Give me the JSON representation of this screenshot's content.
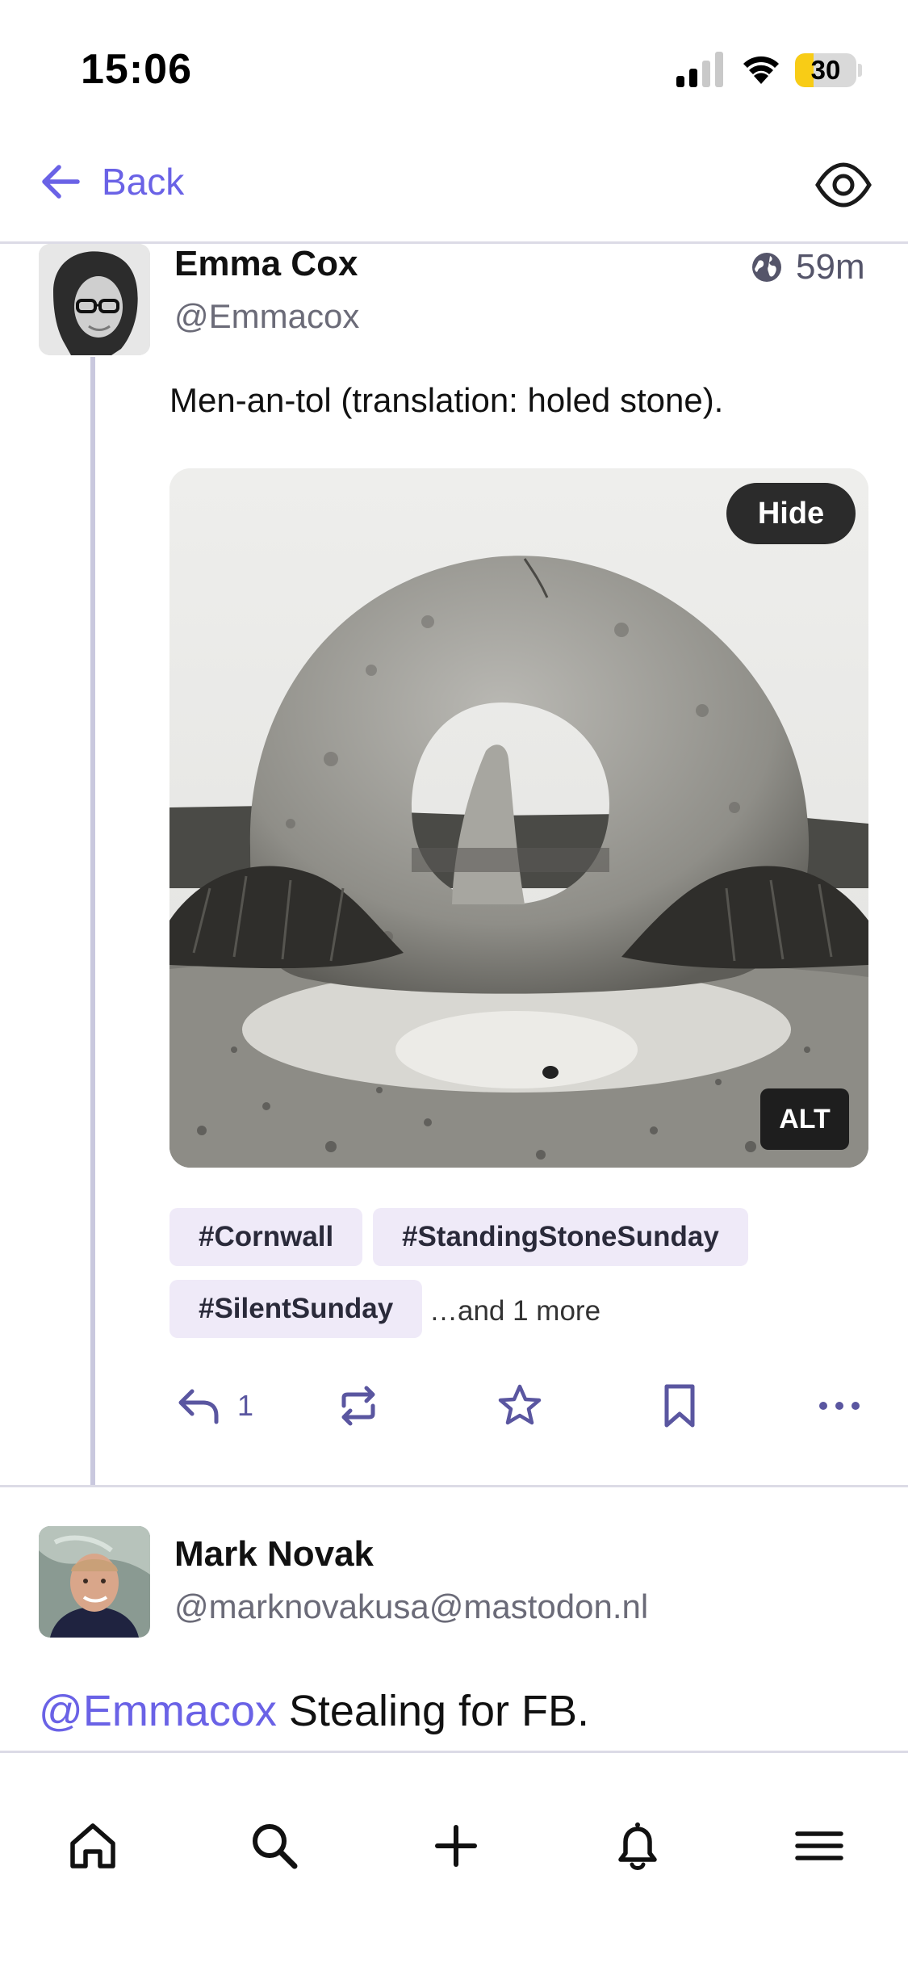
{
  "status_bar": {
    "time": "15:06",
    "battery_level": "30",
    "battery_fraction": 0.3,
    "battery_color": "#f8cc16"
  },
  "nav": {
    "back_label": "Back",
    "back_icon": "arrow-left-icon",
    "right_icon": "eye-icon"
  },
  "colors": {
    "accent": "#6a62e6",
    "tag_background": "#efeaf8",
    "thread_line": "#c9c8de"
  },
  "post": {
    "author_name": "Emma Cox",
    "author_handle": "@Emmacox",
    "visibility_icon": "globe-icon",
    "time_ago": "59m",
    "text": "Men-an-tol (translation: holed stone).",
    "media": {
      "hide_label": "Hide",
      "alt_label": "ALT"
    },
    "tags": [
      "#Cornwall",
      "#StandingStoneSunday",
      "#SilentSunday"
    ],
    "more_tags_label": "…and 1 more",
    "actions": {
      "reply_count": "1",
      "icons": [
        "reply-icon",
        "boost-icon",
        "star-icon",
        "bookmark-icon",
        "more-icon"
      ]
    }
  },
  "reply": {
    "author_name": "Mark Novak",
    "author_handle": "@marknovakusa@mastodon.nl",
    "mention": "@Emmacox",
    "text": " Stealing for FB."
  },
  "tab_bar": {
    "icons": [
      "home-icon",
      "search-icon",
      "plus-icon",
      "bell-icon",
      "menu-icon"
    ]
  }
}
